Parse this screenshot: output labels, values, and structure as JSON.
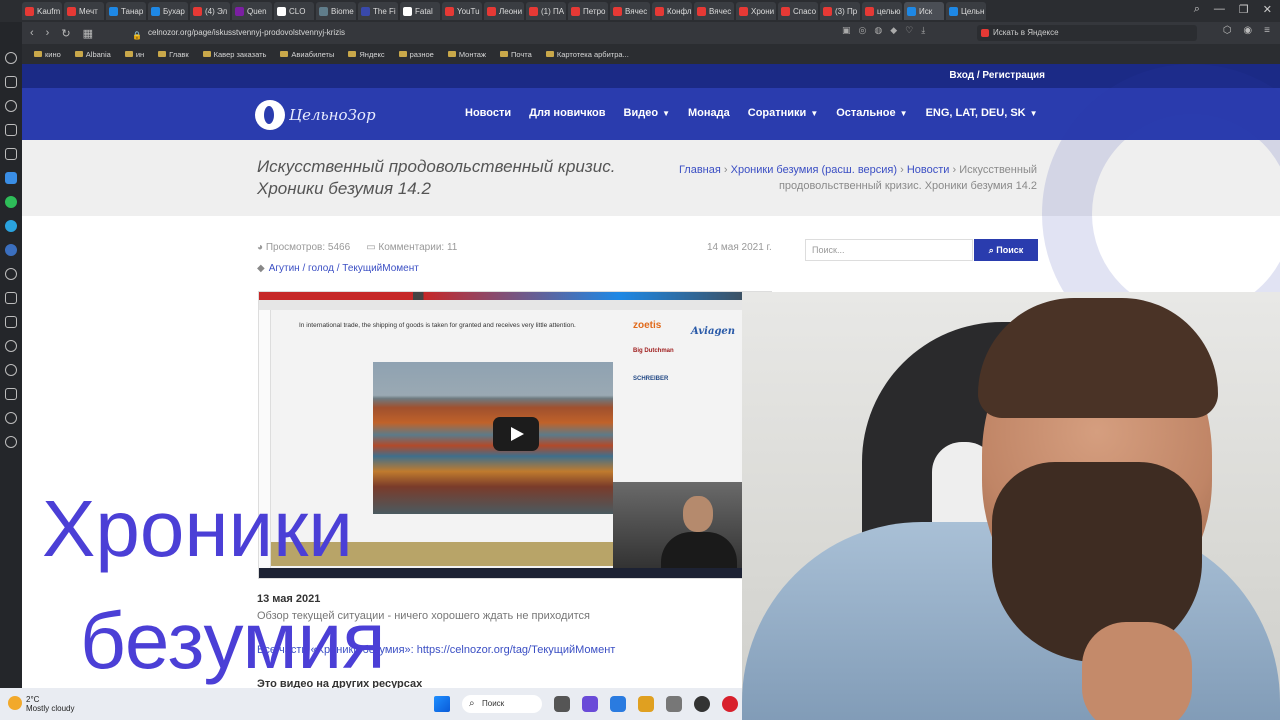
{
  "browser": {
    "tabs": [
      "Kaufm",
      "Мечт",
      "Танар",
      "Бухар",
      "(4) Эл",
      "Quen",
      "CLO",
      "Biome",
      "The Fi",
      "Fatal",
      "YouTu",
      "Леони",
      "(1) ПА",
      "Петро",
      "Вячес",
      "Конфл",
      "Вячес",
      "Хрони",
      "Спасо",
      "(3) Пр",
      "целью",
      "Иск",
      "Цельн"
    ],
    "url": "celnozor.org/page/iskusstvennyj-prodovolstvennyj-krizis",
    "search_label": "Искать в Яндексе",
    "bookmarks": [
      "кино",
      "Albania",
      "ин",
      "Главк",
      "Кавер заказать",
      "Авиабилеты",
      "Яндекс",
      "разное",
      "Монтаж",
      "Почта",
      "Картотека арбитра..."
    ]
  },
  "site": {
    "login": "Вход / Регистрация",
    "logo": "ЦельноЗор",
    "menu": [
      "Новости",
      "Для новичков",
      "Видео",
      "Монада",
      "Соратники",
      "Остальное",
      "ENG, LAT, DEU, SK"
    ],
    "page_title": "Искусственный продовольственный кризис. Хроники безумия 14.2",
    "breadcrumb_home": "Главная",
    "breadcrumb_section": "Хроники безумия (расш. версия)",
    "breadcrumb_news": "Новости",
    "breadcrumb_current": "Искусственный продовольственный кризис. Хроники безумия 14.2",
    "views": "Просмотров: 5466",
    "comments": "Комментарии: 11",
    "date": "14 мая 2021 г.",
    "tags": "Агутин / голод / ТекущийМомент",
    "video_text": "In international trade, the shipping of goods is taken for granted and receives very little attention.",
    "ads": [
      "zoetis",
      "Aviagen",
      "Big Dutchman",
      "SCHREIBER"
    ],
    "post_date": "13 мая 2021",
    "post_desc": "Обзор текущей ситуации - ничего хорошего ждать не приходится",
    "post_link": "Все части «Хроники безумия»: https://celnozor.org/tag/ТекущийМомент",
    "post_other": "Это видео на других ресурсах",
    "search_placeholder": "Поиск...",
    "search_button": "Поиск"
  },
  "overlay": {
    "line1": "Хроники",
    "line2": "безумия"
  },
  "taskbar": {
    "temp": "2°C",
    "weather": "Mostly cloudy",
    "search": "Поиск"
  }
}
